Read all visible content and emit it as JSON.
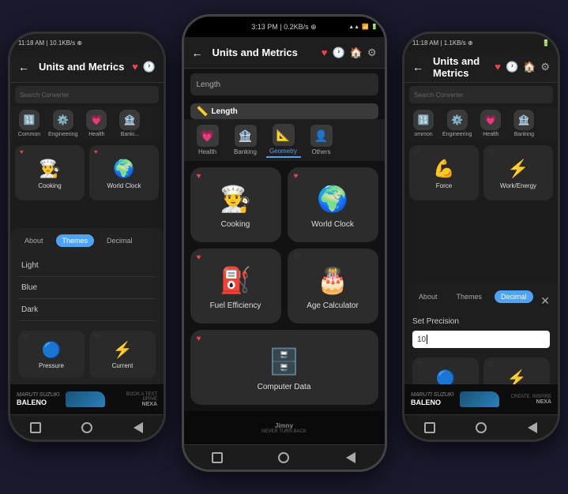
{
  "app": {
    "title": "Units and Metrics",
    "back_arrow": "←",
    "status_time": "3:13 PM | 0.2KB/s ⊕",
    "status_left": "11:18 AM | 10.1KB/s ⊕",
    "status_right": "11:18 AM | 1.1KB/s ⊕",
    "signal_icons": "▲▲▲ WiFi 🔋",
    "search_placeholder": "Length",
    "search_placeholder_small": "Search Converter"
  },
  "categories": {
    "items": [
      {
        "id": "common",
        "label": "Common",
        "icon": "🔢",
        "active": false
      },
      {
        "id": "engineering",
        "label": "Engineering",
        "icon": "⚙️",
        "active": false
      },
      {
        "id": "health",
        "label": "Health",
        "icon": "💗",
        "active": false
      },
      {
        "id": "banking",
        "label": "Banking",
        "icon": "🏦",
        "active": false
      },
      {
        "id": "geometry",
        "label": "Geometry",
        "icon": "📐",
        "active": false
      },
      {
        "id": "others",
        "label": "Others",
        "icon": "👤",
        "active": false
      }
    ],
    "length_tab": "Length"
  },
  "center_grid": [
    {
      "label": "Cooking",
      "icon": "👨‍🍳",
      "fav": true
    },
    {
      "label": "World Clock",
      "icon": "🌍",
      "fav": true
    },
    {
      "label": "Fuel Efficiency",
      "icon": "⛽",
      "fav": true
    },
    {
      "label": "Age Calculator",
      "icon": "🎂",
      "fav": false
    },
    {
      "label": "Computer Data",
      "icon": "🗄️",
      "fav": true
    }
  ],
  "left_grid": [
    {
      "label": "Cooking",
      "icon": "👨‍🍳",
      "fav": true
    },
    {
      "label": "World Clock",
      "icon": "🌍",
      "fav": true
    },
    {
      "label": "Fuel Efficiency",
      "icon": "⛽",
      "fav": true
    },
    {
      "label": "Age Calculator",
      "icon": "🎂",
      "fav": false
    },
    {
      "label": "Pressure",
      "icon": "🔵",
      "fav": false
    },
    {
      "label": "Current",
      "icon": "⚡",
      "fav": false
    }
  ],
  "right_grid": [
    {
      "label": "Force",
      "icon": "💪",
      "fav": false
    },
    {
      "label": "Work/Energy",
      "icon": "⚡",
      "fav": false
    },
    {
      "label": "Pressure",
      "icon": "🔵",
      "fav": false
    },
    {
      "label": "Current",
      "icon": "⚡",
      "fav": false
    }
  ],
  "modal_tabs": [
    {
      "label": "About",
      "active": false
    },
    {
      "label": "Themes",
      "active": true
    },
    {
      "label": "Decimal",
      "active": false
    }
  ],
  "right_modal_tabs": [
    {
      "label": "About",
      "active": false
    },
    {
      "label": "Themes",
      "active": false
    },
    {
      "label": "Decimal",
      "active": true
    }
  ],
  "themes": [
    {
      "label": "Light"
    },
    {
      "label": "Blue"
    },
    {
      "label": "Dark"
    }
  ],
  "decimal": {
    "label": "Set Precision",
    "value": "10"
  },
  "ads": {
    "suzuki_brand": "MARUTI SUZUKI",
    "baleno": "BALENO",
    "book_test_drive": "BOOK A TEST DRIVE",
    "create_inspire": "CREATE. INSPIRE",
    "nexa": "NEXA",
    "jimny": "Jimny",
    "jimny_tagline": "NEVER TURN BACK"
  },
  "bottom_nav": {
    "square": "▪",
    "circle": "●",
    "triangle": "◀"
  }
}
